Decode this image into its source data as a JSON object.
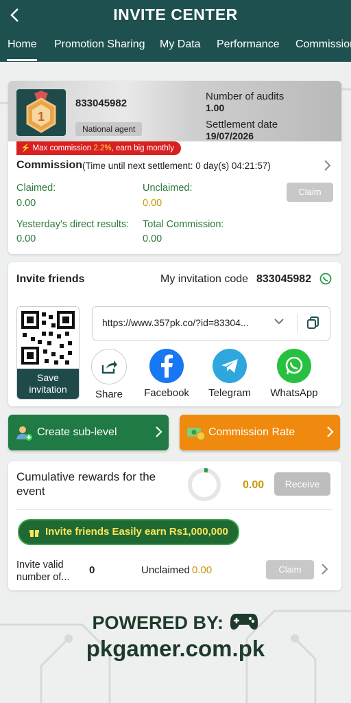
{
  "header": {
    "title": "INVITE CENTER",
    "tabs": [
      "Home",
      "Promotion Sharing",
      "My Data",
      "Performance",
      "Commission"
    ],
    "active_tab": "Home"
  },
  "agent": {
    "id": "833045982",
    "badge": "National agent",
    "medal_number": "1",
    "audits_label": "Number of audits",
    "audits_value": "1.00",
    "settlement_label": "Settlement date",
    "settlement_value": "19/07/2026",
    "promo_prefix": "Max commission ",
    "promo_pct": "2.2%",
    "promo_suffix": ", earn big monthly"
  },
  "commission": {
    "title": "Commission",
    "subtitle": "(Time until next settlement: 0 day(s) 04:21:57)",
    "claimed_label": "Claimed:",
    "claimed_value": "0.00",
    "unclaimed_label": "Unclaimed:",
    "unclaimed_value": "0.00",
    "claim_button": "Claim",
    "yesterday_label": "Yesterday's direct results:",
    "yesterday_value": "0.00",
    "total_label": "Total Commission:",
    "total_value": "0.00"
  },
  "invite": {
    "title": "Invite friends",
    "code_label": "My invitation code",
    "code": "833045982",
    "save_label": "Save invitation",
    "link": "https://www.357pk.co/?id=83304...",
    "share_items": [
      {
        "label": "Share",
        "icon": "share-icon"
      },
      {
        "label": "Facebook",
        "icon": "facebook-icon"
      },
      {
        "label": "Telegram",
        "icon": "telegram-icon"
      },
      {
        "label": "WhatsApp",
        "icon": "whatsapp-icon"
      }
    ]
  },
  "actions": {
    "create_sub_level": "Create sub-level",
    "commission_rate": "Commission Rate"
  },
  "rewards": {
    "title": "Cumulative rewards for the event",
    "value": "0.00",
    "receive_button": "Receive",
    "banner": "Invite friends Easily earn Rs1,000,000",
    "invite_valid_label": "Invite valid number of...",
    "invite_valid_count": "0",
    "unclaimed_label": "Unclaimed",
    "unclaimed_value": "0.00",
    "claim_button": "Claim"
  },
  "watermark": {
    "powered_by": "POWERED BY:",
    "site": "pkgamer.com.pk"
  },
  "colors": {
    "header": "#1f5050",
    "green": "#2d7a3e",
    "gold": "#c89a00",
    "orange": "#ef8a0e",
    "red": "#d92020"
  }
}
